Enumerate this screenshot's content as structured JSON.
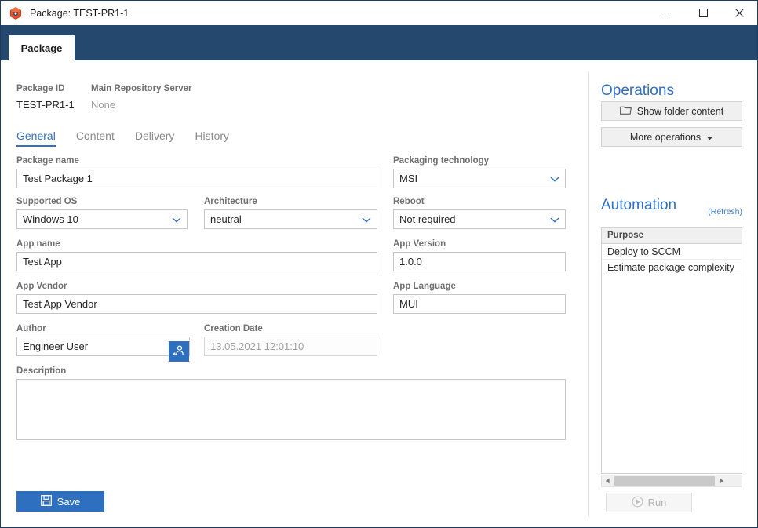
{
  "window": {
    "title": "Package: TEST-PR1-1",
    "app_icon": "package-cube-icon",
    "minimize_label": "—",
    "maximize_label": "□",
    "close_label": "✕",
    "accent_color": "#2f6fc0",
    "titlebar_band_color": "#25496e"
  },
  "app_tab": {
    "label": "Package"
  },
  "meta": {
    "package_id_label": "Package ID",
    "package_id_value": "TEST-PR1-1",
    "repository_label": "Main Repository Server",
    "repository_value": "None"
  },
  "subtabs": [
    {
      "label": "General",
      "active": true
    },
    {
      "label": "Content",
      "active": false
    },
    {
      "label": "Delivery",
      "active": false
    },
    {
      "label": "History",
      "active": false
    }
  ],
  "form": {
    "package_name": {
      "label": "Package name",
      "value": "Test Package 1"
    },
    "packaging_technology": {
      "label": "Packaging technology",
      "value": "MSI"
    },
    "supported_os": {
      "label": "Supported OS",
      "value": "Windows 10"
    },
    "architecture": {
      "label": "Architecture",
      "value": "neutral"
    },
    "reboot": {
      "label": "Reboot",
      "value": "Not required"
    },
    "app_name": {
      "label": "App name",
      "value": "Test App"
    },
    "app_version": {
      "label": "App Version",
      "value": "1.0.0"
    },
    "app_vendor": {
      "label": "App Vendor",
      "value": "Test App Vendor"
    },
    "app_language": {
      "label": "App Language",
      "value": "MUI"
    },
    "author": {
      "label": "Author",
      "value": "Engineer User",
      "picker_icon": "user-insert-icon"
    },
    "creation_date": {
      "label": "Creation Date",
      "value": "13.05.2021 12:01:10",
      "disabled": true
    },
    "description": {
      "label": "Description",
      "value": "",
      "placeholder": ""
    }
  },
  "save_button": {
    "label": "Save",
    "icon": "floppy-save-icon"
  },
  "operations": {
    "title": "Operations",
    "show_folder_content": {
      "label": "Show folder content",
      "icon": "folder-icon"
    },
    "more_operations": {
      "label": "More operations",
      "icon": "chevron-down-icon"
    }
  },
  "automation": {
    "title": "Automation",
    "refresh_label": "(Refresh)",
    "columns": [
      "Purpose"
    ],
    "rows": [
      {
        "purpose": "Deploy to SCCM"
      },
      {
        "purpose": "Estimate package complexity"
      }
    ],
    "run_button": {
      "label": "Run",
      "icon": "play-circle-icon",
      "disabled": true
    },
    "scrollbar": {
      "left_arrow": "◀",
      "right_arrow": "▶"
    }
  }
}
